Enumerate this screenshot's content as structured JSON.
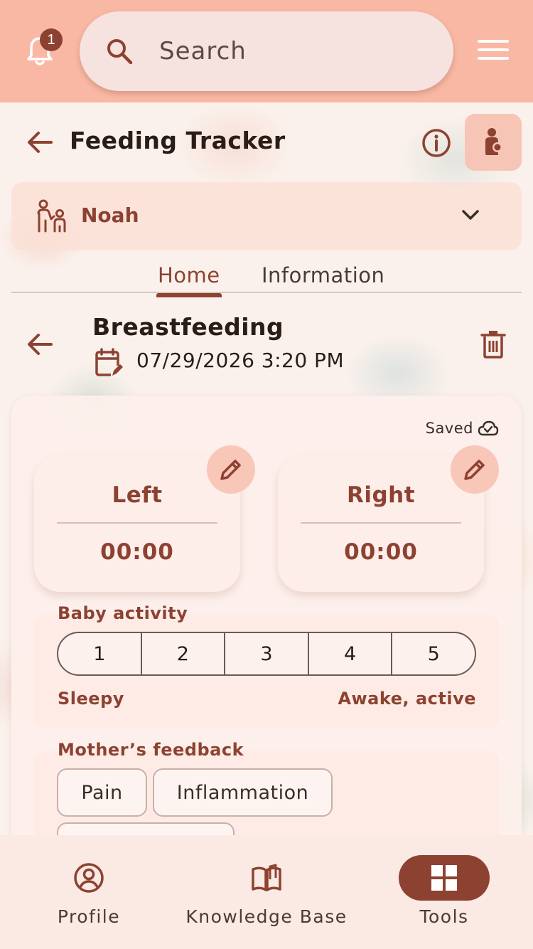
{
  "colors": {
    "accent": "#8d4231",
    "topbar": "#f9b8a4",
    "badge": "#8d4231"
  },
  "header": {
    "notification_count": "1",
    "search_placeholder": "Search"
  },
  "page": {
    "title": "Feeding Tracker"
  },
  "child": {
    "name": "Noah"
  },
  "tabs": [
    {
      "label": "Home",
      "active": true
    },
    {
      "label": "Information",
      "active": false
    }
  ],
  "entry": {
    "title": "Breastfeeding",
    "datetime": "07/29/2026 3:20 PM",
    "status": "Saved"
  },
  "sides": [
    {
      "label": "Left",
      "time": "00:00"
    },
    {
      "label": "Right",
      "time": "00:00"
    }
  ],
  "activity": {
    "title": "Baby activity",
    "options": [
      "1",
      "2",
      "3",
      "4",
      "5"
    ],
    "low_label": "Sleepy",
    "high_label": "Awake, active"
  },
  "feedback": {
    "title": "Mother’s feedback",
    "chips": [
      "Pain",
      "Inflammation",
      ""
    ]
  },
  "bottom_nav": [
    {
      "label": "Profile",
      "icon": "profile-icon",
      "active": false
    },
    {
      "label": "Knowledge Base",
      "icon": "book-icon",
      "active": false
    },
    {
      "label": "Tools",
      "icon": "grid-icon",
      "active": true
    }
  ]
}
